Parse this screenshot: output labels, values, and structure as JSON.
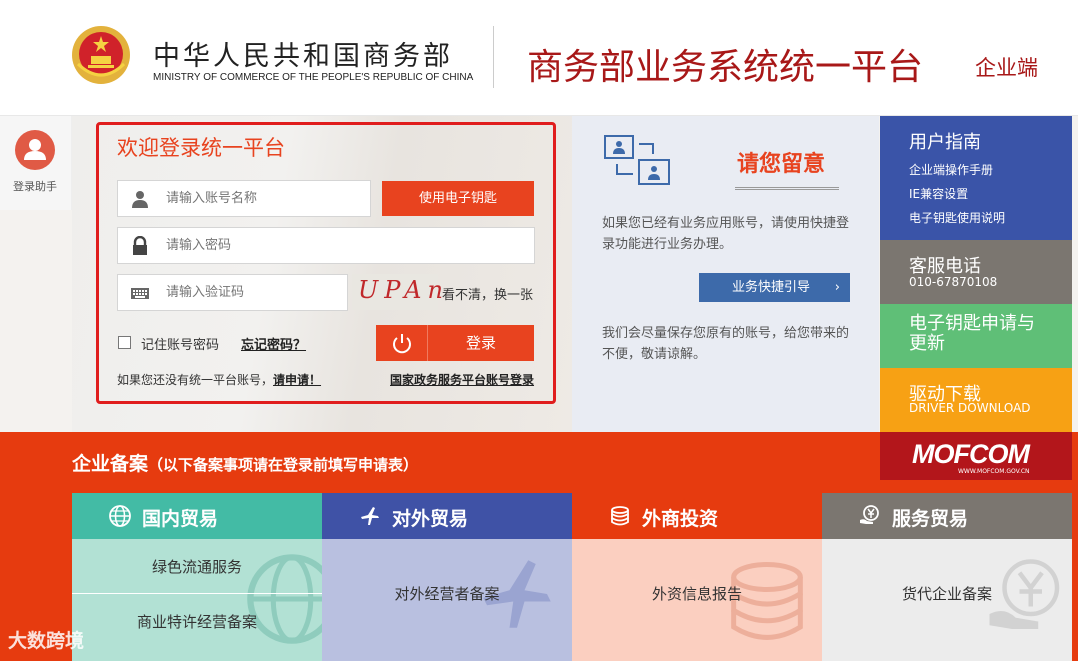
{
  "header": {
    "org_cn": "中华人民共和国商务部",
    "org_en": "MINISTRY OF COMMERCE OF THE PEOPLE'S REPUBLIC OF CHINA",
    "system_title": "商务部业务系统统一平台",
    "system_sub": "企业端"
  },
  "helper": {
    "label": "登录助手",
    "icon": "user-icon"
  },
  "login": {
    "title": "欢迎登录统一平台",
    "username_placeholder": "请输入账号名称",
    "password_placeholder": "请输入密码",
    "captcha_placeholder": "请输入验证码",
    "captcha_text": "UPAn",
    "refresh_label": "看不清，换一张",
    "key_button": "使用电子钥匙",
    "remember_label": "记住账号密码",
    "forget_label": "忘记密码？",
    "login_button": "登录",
    "register_prefix": "如果您还没有统一平台账号，",
    "register_link": "请申请！",
    "national_link": "国家政务服务平台账号登录"
  },
  "notice": {
    "title": "请您留意",
    "p1": "如果您已经有业务应用账号，请使用快捷登录功能进行业务办理。",
    "guide_button": "业务快捷引导",
    "p2": "我们会尽量保存您原有的账号，给您带来的不便，敬请谅解。"
  },
  "right_menu": {
    "guide_title": "用户指南",
    "guide_items": [
      "企业端操作手册",
      "IE兼容设置",
      "电子钥匙使用说明"
    ],
    "hotline_title": "客服电话",
    "hotline_number": "010-67870108",
    "key_title": "电子钥匙申请与更新",
    "driver_title": "驱动下载",
    "driver_sub": "DRIVER DOWNLOAD"
  },
  "logo": {
    "text": "MOFCOM",
    "url": "WWW.MOFCOM.GOV.CN"
  },
  "filing": {
    "title": "企业备案",
    "note": "（以下备案事项请在登录前填写申请表）",
    "columns": [
      {
        "label": "国内贸易",
        "icon": "globe-icon",
        "items": [
          "绿色流通服务",
          "商业特许经营备案"
        ]
      },
      {
        "label": "对外贸易",
        "icon": "plane-icon",
        "items": [
          "对外经营者备案"
        ]
      },
      {
        "label": "外商投资",
        "icon": "coins-icon",
        "items": [
          "外资信息报告"
        ]
      },
      {
        "label": "服务贸易",
        "icon": "yuan-hand-icon",
        "items": [
          "货代企业备案"
        ]
      }
    ]
  },
  "watermark": "大数跨境",
  "colors": {
    "brand_red": "#a81818",
    "accent_orange": "#e8431f",
    "band_orange": "#e63b0f",
    "blue": "#3a54a8",
    "teal": "#43bba5"
  }
}
